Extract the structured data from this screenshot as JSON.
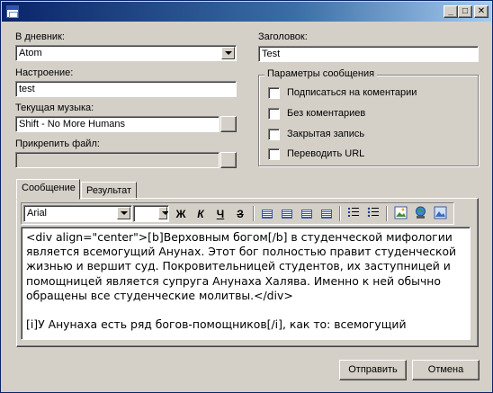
{
  "window": {
    "minimize_glyph": "_",
    "maximize_glyph": "□",
    "close_glyph": "✕"
  },
  "form": {
    "diary_label": "В дневник:",
    "diary_value": "Atom",
    "mood_label": "Настроение:",
    "mood_value": "test",
    "music_label": "Текущая музыка:",
    "music_value": "Shift - No More Humans",
    "attach_label": "Прикрепить файл:",
    "attach_value": "",
    "title_label": "Заголовок:",
    "title_value": "Test"
  },
  "params": {
    "title": "Параметры сообщения",
    "options": [
      {
        "label": "Подписаться на коментарии",
        "checked": false
      },
      {
        "label": "Без коментариев",
        "checked": false
      },
      {
        "label": "Закрытая запись",
        "checked": false
      },
      {
        "label": "Переводить URL",
        "checked": false
      }
    ]
  },
  "tabs": [
    {
      "label": "Сообщение",
      "active": true
    },
    {
      "label": "Результат",
      "active": false
    }
  ],
  "toolbar": {
    "font_value": "Arial",
    "size_value": "",
    "bold": "Ж",
    "italic": "К",
    "underline": "Ч",
    "strike": "З"
  },
  "editor": {
    "text": "<div align=\"center\">[b]Верховным богом[/b] в студенческой мифологии является всемогущий Анунах. Этот бог полностью правит студенческой жизнью и вершит суд. Покровительницей студентов, их заступницей и помощницей является супруга Анунаха Халява. Именно к ней обычно обращены все студенческие молитвы.</div>\n\n[i]У Анунаха есть ряд богов-помощников[/i], как то: всемогущий"
  },
  "buttons": {
    "send": "Отправить",
    "cancel": "Отмена"
  }
}
